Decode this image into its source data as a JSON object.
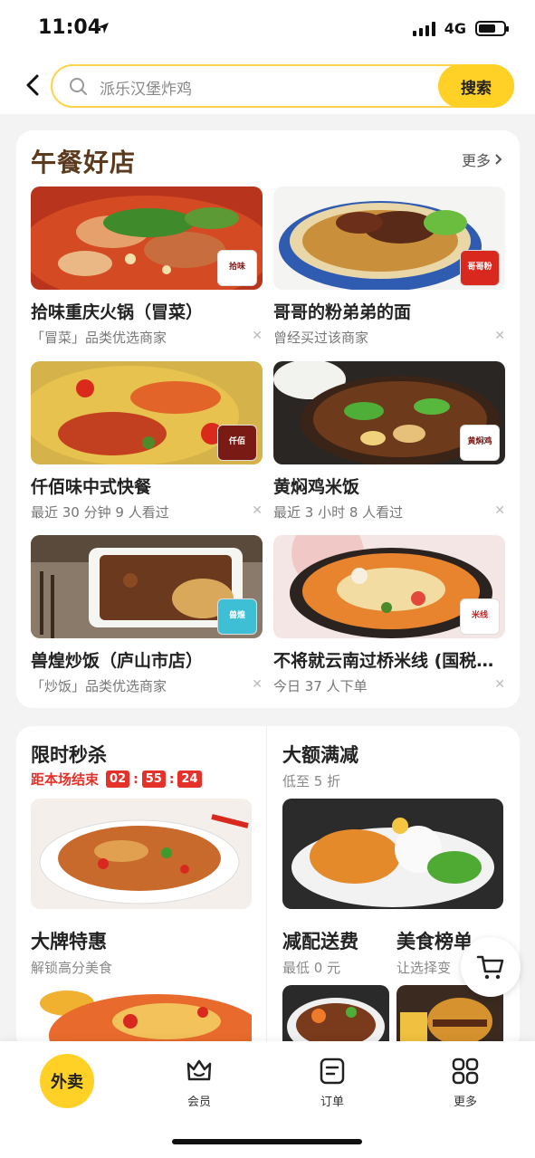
{
  "status": {
    "time": "11:04",
    "network": "4G"
  },
  "search": {
    "placeholder": "派乐汉堡炸鸡",
    "button": "搜索"
  },
  "lunch": {
    "title": "午餐好店",
    "more": "更多",
    "shops": [
      {
        "name": "拾味重庆火锅（冒菜）",
        "sub": "「冒菜」品类优选商家",
        "logo": "拾味"
      },
      {
        "name": "哥哥的粉弟弟的面",
        "sub": "曾经买过该商家",
        "logo": "哥哥粉"
      },
      {
        "name": "仟佰味中式快餐",
        "sub": "最近 30 分钟 9 人看过",
        "logo": "仟佰"
      },
      {
        "name": "黄焖鸡米饭",
        "sub": "最近 3 小时 8 人看过",
        "logo": "黄焖鸡"
      },
      {
        "name": "兽煌炒饭（庐山市店）",
        "sub": "「炒饭」品类优选商家",
        "logo": "兽煌"
      },
      {
        "name": "不将就云南过桥米线 (国税…",
        "sub": "今日 37 人下单",
        "logo": "米线"
      }
    ]
  },
  "promo": {
    "flash": {
      "title": "限时秒杀",
      "countdown_label": "距本场结束",
      "h": "02",
      "m": "55",
      "s": "24"
    },
    "discount": {
      "title": "大额满减",
      "sub": "低至 5 折"
    },
    "brand": {
      "title": "大牌特惠",
      "sub": "解锁高分美食"
    },
    "delivery": {
      "title": "减配送费",
      "sub": "最低 0 元"
    },
    "ranking": {
      "title": "美食榜单",
      "sub": "让选择变"
    }
  },
  "nav": {
    "home": "外卖",
    "member": "会员",
    "orders": "订单",
    "more": "更多"
  },
  "colors": {
    "accent": "#ffd026",
    "red": "#e4322b",
    "title_brown": "#5b3a1e"
  }
}
